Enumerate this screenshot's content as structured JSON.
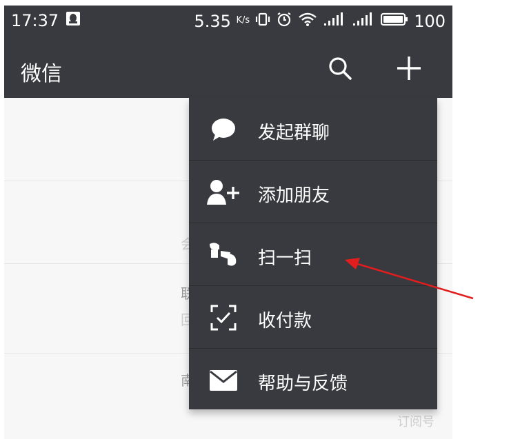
{
  "status_bar": {
    "time": "17:37",
    "network_speed": "5.35",
    "speed_unit": "K/s",
    "battery": "100"
  },
  "app_bar": {
    "title": "微信"
  },
  "list_fragments": [
    "会",
    "联",
    "回",
    "南",
    "订阅号"
  ],
  "menu": {
    "items": [
      {
        "label": "发起群聊",
        "icon": "chat-bubble-icon"
      },
      {
        "label": "添加朋友",
        "icon": "add-friend-icon"
      },
      {
        "label": "扫一扫",
        "icon": "scan-icon"
      },
      {
        "label": "收付款",
        "icon": "payment-icon"
      },
      {
        "label": "帮助与反馈",
        "icon": "mail-icon"
      }
    ]
  },
  "colors": {
    "bar_bg": "#393a3f",
    "menu_bg": "#393a3f",
    "annotation_arrow": "#e11d1d"
  }
}
